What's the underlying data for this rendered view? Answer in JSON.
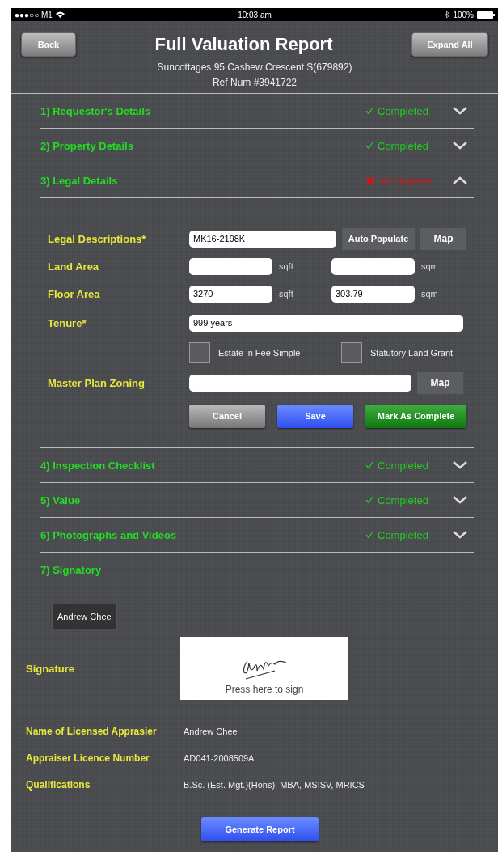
{
  "status_bar": {
    "carrier": "●●●○○ M1",
    "time": "10:03 am",
    "battery": "100%"
  },
  "header": {
    "back": "Back",
    "title": "Full Valuation Report",
    "expand": "Expand All",
    "address": "Suncottages 95 Cashew Crescent S(679892)",
    "ref": "Ref Num #3941722"
  },
  "sections_before": [
    {
      "title": "1) Requestor's Details",
      "status": {
        "kind": "completed",
        "label": "Completed"
      },
      "expanded": false
    },
    {
      "title": "2) Property Details",
      "status": {
        "kind": "completed",
        "label": "Completed"
      },
      "expanded": false
    },
    {
      "title": "3) Legal Details",
      "status": {
        "kind": "incomplete",
        "label": "Incomplete"
      },
      "expanded": true
    }
  ],
  "legal_form": {
    "legal_descriptions": {
      "label": "Legal Descriptions*",
      "value": "MK16-2198K",
      "auto": "Auto Populate",
      "map": "Map"
    },
    "land_area": {
      "label": "Land Area",
      "sqft_unit": "sqft",
      "sqm_unit": "sqm"
    },
    "floor_area": {
      "label": "Floor Area",
      "sqft": "3270",
      "sqft_unit": "sqft",
      "sqm": "303.79",
      "sqm_unit": "sqm"
    },
    "tenure": {
      "label": "Tenure*",
      "value": "999 years"
    },
    "checkboxes": [
      {
        "label": "Estate in Fee Simple",
        "checked": false
      },
      {
        "label": "Statutory Land Grant",
        "checked": false
      }
    ],
    "zoning": {
      "label": "Master Plan Zoning",
      "map": "Map"
    },
    "buttons": [
      {
        "label": "Cancel",
        "kind": "grey"
      },
      {
        "label": "Save",
        "kind": "blue"
      },
      {
        "label": "Mark As Complete",
        "kind": "green"
      }
    ]
  },
  "sections_after": [
    {
      "title": "4) Inspection Checklist",
      "status": {
        "kind": "completed",
        "label": "Completed"
      },
      "expanded": false
    },
    {
      "title": "5) Value",
      "status": {
        "kind": "completed",
        "label": "Completed"
      },
      "expanded": false
    },
    {
      "title": "6) Photographs and Videos",
      "status": {
        "kind": "completed",
        "label": "Completed"
      },
      "expanded": false
    },
    {
      "title": "7) Signatory",
      "status": {
        "kind": "none"
      }
    }
  ],
  "signatory": {
    "chip": "Andrew Chee",
    "signature_label": "Signature",
    "signature_hint": "Press here to sign",
    "details": [
      {
        "label": "Name of Licensed Apprasier",
        "value": "Andrew Chee"
      },
      {
        "label": "Appraiser Licence Number",
        "value": "AD041-2008509A"
      },
      {
        "label": "Qualifications",
        "value": "B.Sc. (Est. Mgt.)(Hons), MBA, MSISV, MRICS"
      }
    ],
    "generate": "Generate Report"
  }
}
